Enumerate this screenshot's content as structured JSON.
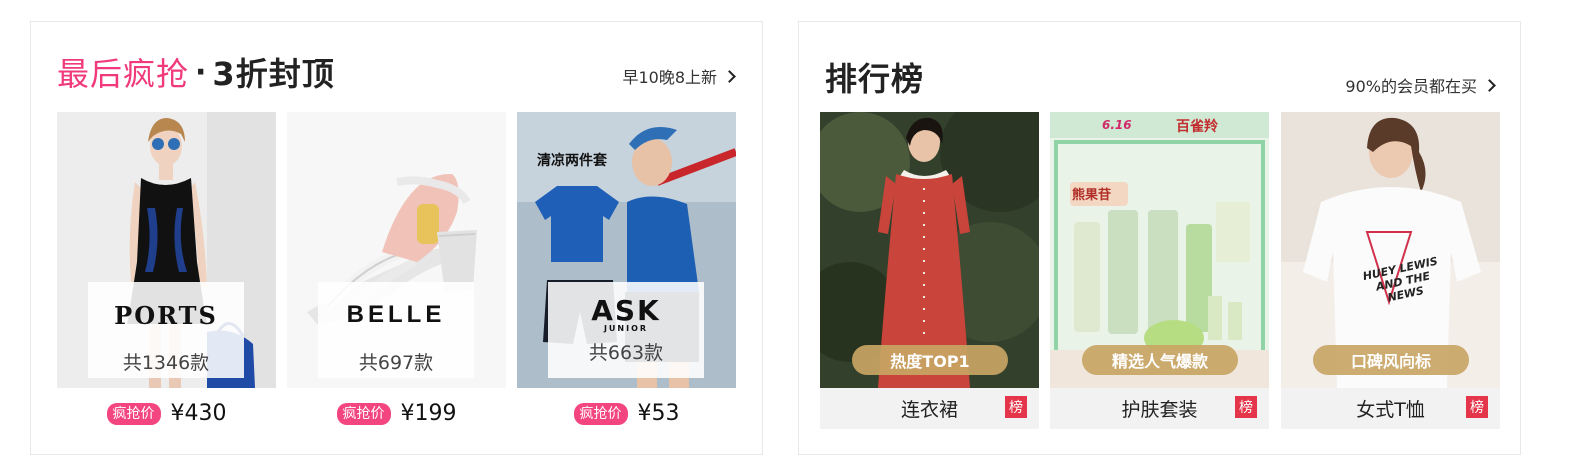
{
  "flash_sale": {
    "title_accent": "最后疯抢",
    "title_sep": "·",
    "title_main": "3折封顶",
    "more_label": "早10晚8上新",
    "items": [
      {
        "brand": "PORTS",
        "count": "共1346款",
        "tag": "疯抢价",
        "price": "¥430"
      },
      {
        "brand": "BELLE",
        "count": "共697款",
        "tag": "疯抢价",
        "price": "¥199"
      },
      {
        "brand": "ASK",
        "brand_sub": "JUNIOR",
        "count": "共663款",
        "tag": "疯抢价",
        "price": "¥53",
        "photo_caption": "清凉两件套"
      }
    ]
  },
  "ranking": {
    "title": "排行榜",
    "more_label": "90%的会员都在买",
    "items": [
      {
        "pill": "热度TOP1",
        "name": "连衣裙",
        "badge": "榜"
      },
      {
        "pill": "精选人气爆款",
        "name": "护肤套装",
        "badge": "榜",
        "banner_event": "6.16",
        "banner_brand": "百雀羚",
        "box_label": "熊果苷"
      },
      {
        "pill": "口碑风向标",
        "name": "女式T恤",
        "badge": "榜",
        "shirt_print": "HUEY LEWIS AND THE NEWS"
      }
    ]
  },
  "colors": {
    "accent_pink": "#f13a7c",
    "tag_pink": "#f3457f",
    "badge_red": "#e4354a",
    "pill_gold": "#c8a564"
  }
}
